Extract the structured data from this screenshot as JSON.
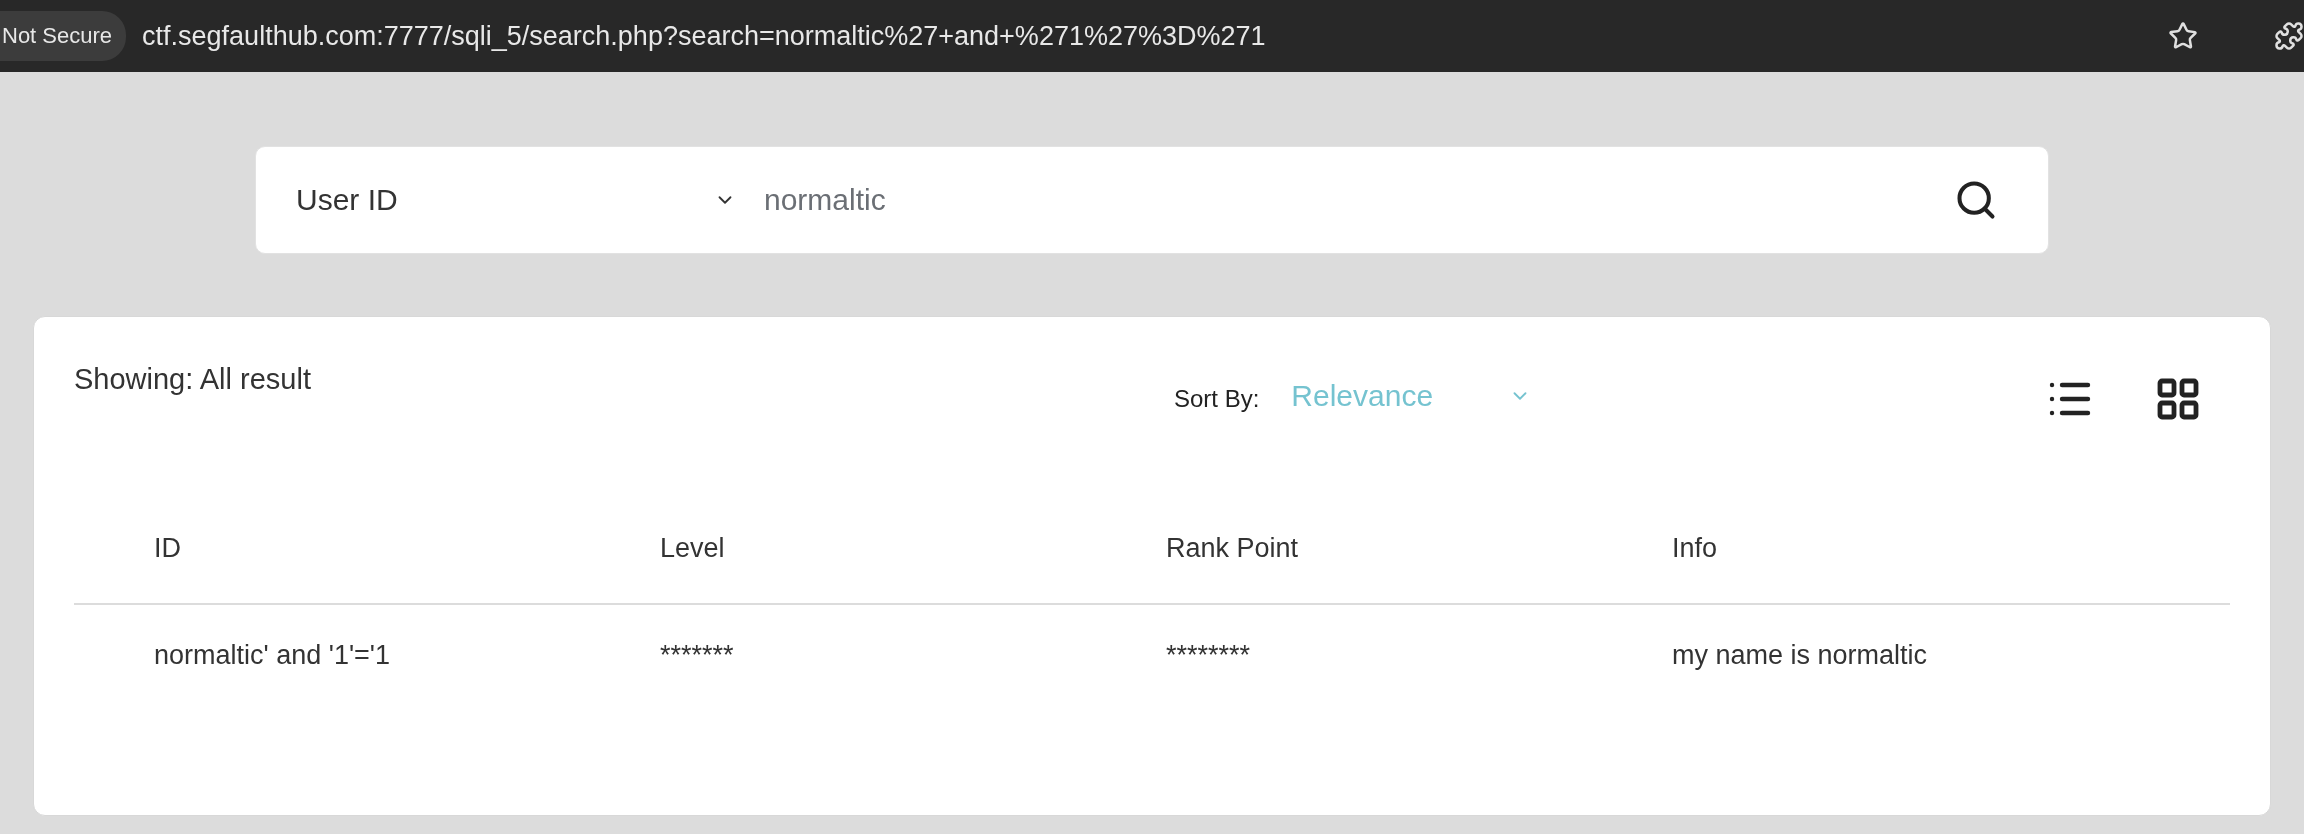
{
  "browser": {
    "security_label": "Not Secure",
    "url": "ctf.segfaulthub.com:7777/sqli_5/search.php?search=normaltic%27+and+%271%27%3D%271"
  },
  "search": {
    "field_select": "User ID",
    "value": "normaltic"
  },
  "results": {
    "showing": "Showing: All result",
    "sort_label": "Sort By:",
    "sort_value": "Relevance",
    "table": {
      "columns": [
        "ID",
        "Level",
        "Rank Point",
        "Info"
      ],
      "rows": [
        [
          "normaltic' and '1'='1",
          "*******",
          "********",
          "my name is normaltic"
        ]
      ]
    }
  }
}
